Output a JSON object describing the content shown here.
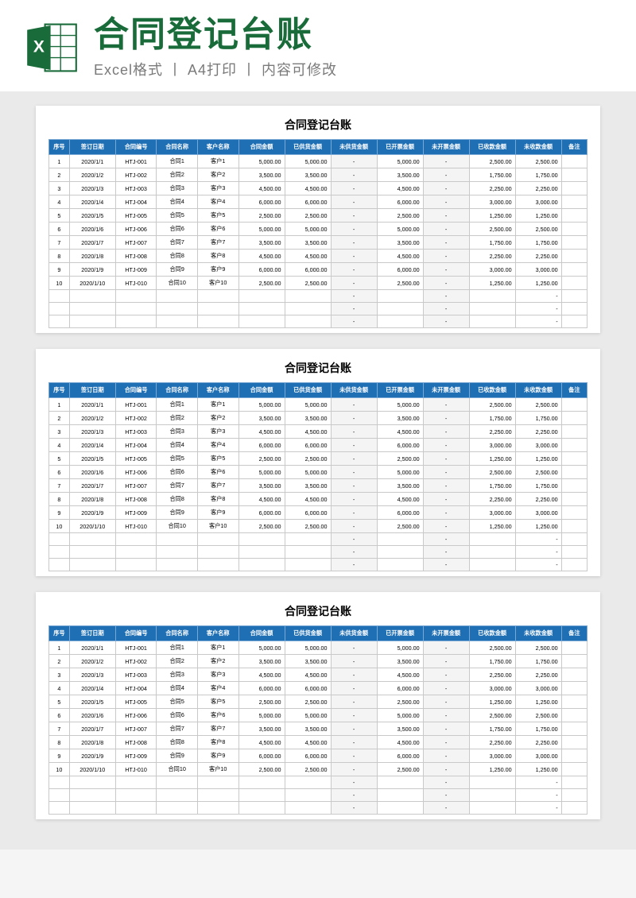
{
  "header": {
    "main_title": "合同登记台账",
    "sub_title": "Excel格式 丨 A4打印 丨 内容可修改"
  },
  "sheet_title": "合同登记台账",
  "columns": [
    "序号",
    "签订日期",
    "合同编号",
    "合同名称",
    "客户名称",
    "合同金额",
    "已供货金额",
    "未供货金额",
    "已开票金额",
    "未开票金额",
    "已收款金额",
    "未收款金额",
    "备注"
  ],
  "rows": [
    {
      "idx": "1",
      "date": "2020/1/1",
      "code": "HTJ-001",
      "name": "合同1",
      "cust": "客户1",
      "amt": "5,000.00",
      "sup": "5,000.00",
      "inv": "5,000.00",
      "rec": "2,500.00",
      "unrec": "2,500.00"
    },
    {
      "idx": "2",
      "date": "2020/1/2",
      "code": "HTJ-002",
      "name": "合同2",
      "cust": "客户2",
      "amt": "3,500.00",
      "sup": "3,500.00",
      "inv": "3,500.00",
      "rec": "1,750.00",
      "unrec": "1,750.00"
    },
    {
      "idx": "3",
      "date": "2020/1/3",
      "code": "HTJ-003",
      "name": "合同3",
      "cust": "客户3",
      "amt": "4,500.00",
      "sup": "4,500.00",
      "inv": "4,500.00",
      "rec": "2,250.00",
      "unrec": "2,250.00"
    },
    {
      "idx": "4",
      "date": "2020/1/4",
      "code": "HTJ-004",
      "name": "合同4",
      "cust": "客户4",
      "amt": "6,000.00",
      "sup": "6,000.00",
      "inv": "6,000.00",
      "rec": "3,000.00",
      "unrec": "3,000.00"
    },
    {
      "idx": "5",
      "date": "2020/1/5",
      "code": "HTJ-005",
      "name": "合同5",
      "cust": "客户5",
      "amt": "2,500.00",
      "sup": "2,500.00",
      "inv": "2,500.00",
      "rec": "1,250.00",
      "unrec": "1,250.00"
    },
    {
      "idx": "6",
      "date": "2020/1/6",
      "code": "HTJ-006",
      "name": "合同6",
      "cust": "客户6",
      "amt": "5,000.00",
      "sup": "5,000.00",
      "inv": "5,000.00",
      "rec": "2,500.00",
      "unrec": "2,500.00"
    },
    {
      "idx": "7",
      "date": "2020/1/7",
      "code": "HTJ-007",
      "name": "合同7",
      "cust": "客户7",
      "amt": "3,500.00",
      "sup": "3,500.00",
      "inv": "3,500.00",
      "rec": "1,750.00",
      "unrec": "1,750.00"
    },
    {
      "idx": "8",
      "date": "2020/1/8",
      "code": "HTJ-008",
      "name": "合同8",
      "cust": "客户8",
      "amt": "4,500.00",
      "sup": "4,500.00",
      "inv": "4,500.00",
      "rec": "2,250.00",
      "unrec": "2,250.00"
    },
    {
      "idx": "9",
      "date": "2020/1/9",
      "code": "HTJ-009",
      "name": "合同9",
      "cust": "客户9",
      "amt": "6,000.00",
      "sup": "6,000.00",
      "inv": "6,000.00",
      "rec": "3,000.00",
      "unrec": "3,000.00"
    },
    {
      "idx": "10",
      "date": "2020/1/10",
      "code": "HTJ-010",
      "name": "合同10",
      "cust": "客户10",
      "amt": "2,500.00",
      "sup": "2,500.00",
      "inv": "2,500.00",
      "rec": "1,250.00",
      "unrec": "1,250.00"
    }
  ],
  "empty_rows_count": 3,
  "dash": "-"
}
